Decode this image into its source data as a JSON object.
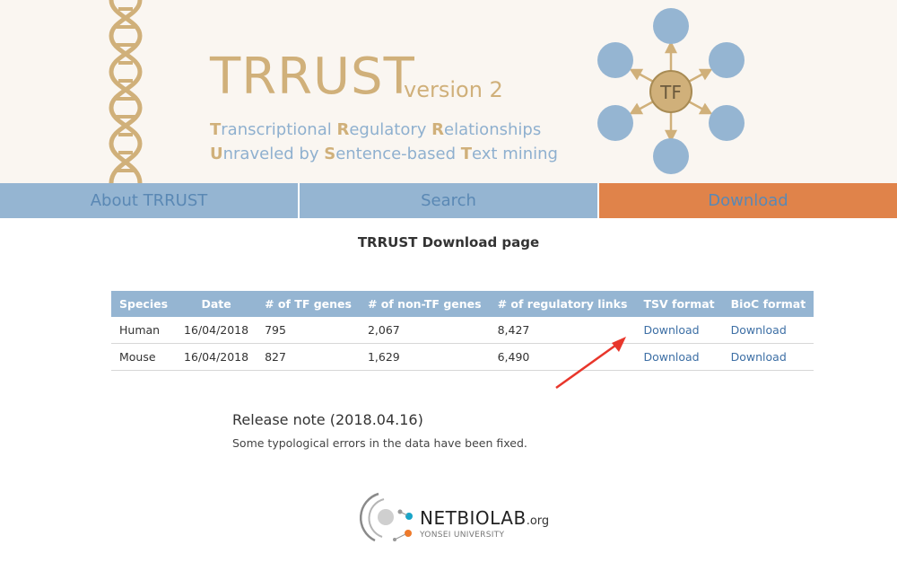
{
  "header": {
    "title": "TRRUST",
    "version": "version 2",
    "tagline1": [
      {
        "cap": "T",
        "rest": "ranscriptional "
      },
      {
        "cap": "R",
        "rest": "egulatory "
      },
      {
        "cap": "R",
        "rest": "elationships"
      }
    ],
    "tagline2": [
      {
        "cap": "U",
        "rest": "nraveled by "
      },
      {
        "cap": "S",
        "rest": "entence-based "
      },
      {
        "cap": "T",
        "rest": "ext mining"
      }
    ],
    "tf_label": "TF",
    "colors": {
      "gold": "#d0b07a",
      "blue": "#95b5d2",
      "accent": "#e0834a"
    }
  },
  "nav": {
    "about": "About TRRUST",
    "search": "Search",
    "download": "Download"
  },
  "page": {
    "title": "TRRUST Download page"
  },
  "table": {
    "headers": [
      "Species",
      "Date",
      "# of TF genes",
      "# of non-TF genes",
      "# of regulatory links",
      "TSV format",
      "BioC format"
    ],
    "rows": [
      {
        "species": "Human",
        "date": "16/04/2018",
        "tf": "795",
        "nontf": "2,067",
        "links": "8,427",
        "tsv": "Download",
        "bioc": "Download"
      },
      {
        "species": "Mouse",
        "date": "16/04/2018",
        "tf": "827",
        "nontf": "1,629",
        "links": "6,490",
        "tsv": "Download",
        "bioc": "Download"
      }
    ]
  },
  "release": {
    "title": "Release note (2018.04.16)",
    "text": "Some typological errors in the data have been fixed."
  },
  "footer": {
    "name": "NETBIOLAB",
    "domain": ".org",
    "university": "YONSEI UNIVERSITY"
  },
  "annotation": {
    "arrow_color": "#e8362b"
  }
}
